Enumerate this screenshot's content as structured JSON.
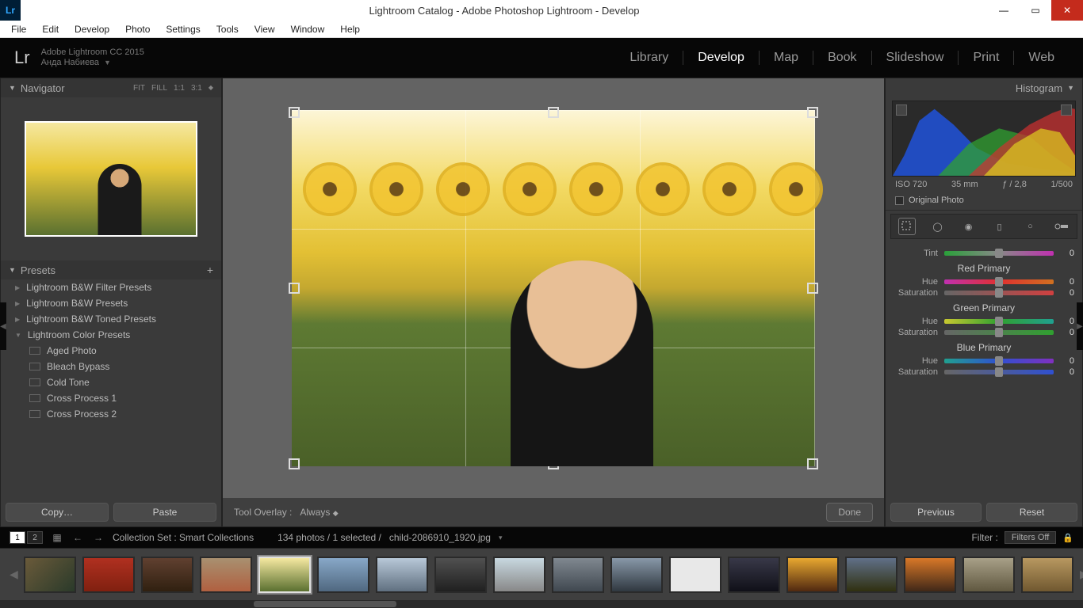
{
  "window": {
    "title": "Lightroom Catalog - Adobe Photoshop Lightroom - Develop",
    "lr_badge": "Lr"
  },
  "menubar": [
    "File",
    "Edit",
    "Develop",
    "Photo",
    "Settings",
    "Tools",
    "View",
    "Window",
    "Help"
  ],
  "identity": {
    "logo": "Lr",
    "line1": "Adobe Lightroom CC 2015",
    "line2": "Анда Набиева"
  },
  "modules": [
    {
      "label": "Library",
      "active": false
    },
    {
      "label": "Develop",
      "active": true
    },
    {
      "label": "Map",
      "active": false
    },
    {
      "label": "Book",
      "active": false
    },
    {
      "label": "Slideshow",
      "active": false
    },
    {
      "label": "Print",
      "active": false
    },
    {
      "label": "Web",
      "active": false
    }
  ],
  "left": {
    "navigator": {
      "title": "Navigator",
      "zoom": [
        "FIT",
        "FILL",
        "1:1",
        "3:1"
      ]
    },
    "presets": {
      "title": "Presets",
      "groups": [
        {
          "label": "Lightroom B&W Filter Presets",
          "open": false
        },
        {
          "label": "Lightroom B&W Presets",
          "open": false
        },
        {
          "label": "Lightroom B&W Toned Presets",
          "open": false
        },
        {
          "label": "Lightroom Color Presets",
          "open": true,
          "items": [
            "Aged Photo",
            "Bleach Bypass",
            "Cold Tone",
            "Cross Process 1",
            "Cross Process 2"
          ]
        }
      ]
    },
    "copy": "Copy…",
    "paste": "Paste"
  },
  "center": {
    "tool_overlay_label": "Tool Overlay :",
    "tool_overlay_value": "Always",
    "done": "Done"
  },
  "right": {
    "histogram_title": "Histogram",
    "exif": {
      "iso": "ISO 720",
      "focal": "35 mm",
      "aperture": "ƒ / 2,8",
      "shutter": "1/500"
    },
    "original_label": "Original Photo",
    "adjust": {
      "tint": {
        "label": "Tint",
        "value": 0
      },
      "red": {
        "title": "Red Primary",
        "hue": {
          "label": "Hue",
          "value": 0
        },
        "sat": {
          "label": "Saturation",
          "value": 0
        }
      },
      "green": {
        "title": "Green Primary",
        "hue": {
          "label": "Hue",
          "value": 0
        },
        "sat": {
          "label": "Saturation",
          "value": 0
        }
      },
      "blue": {
        "title": "Blue Primary",
        "hue": {
          "label": "Hue",
          "value": 0
        },
        "sat": {
          "label": "Saturation",
          "value": 0
        }
      }
    },
    "previous": "Previous",
    "reset": "Reset"
  },
  "filmstrip": {
    "view_numbers": [
      "1",
      "2"
    ],
    "collection_label": "Collection Set : Smart Collections",
    "count_text": "134 photos / 1 selected /",
    "filename": "child-2086910_1920.jpg",
    "filter_label": "Filter :",
    "filter_value": "Filters Off"
  }
}
